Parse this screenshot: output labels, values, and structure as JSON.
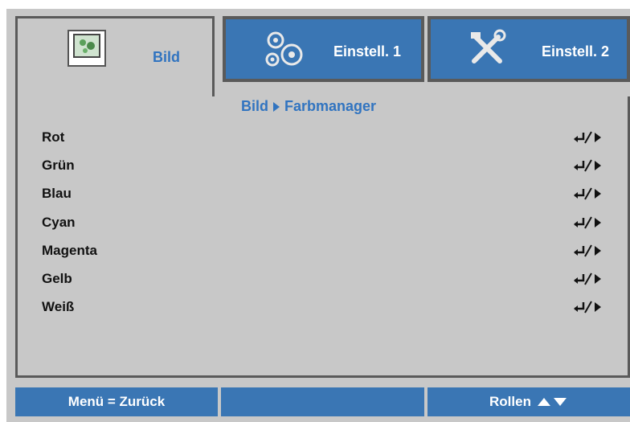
{
  "colors": {
    "accent": "#3174c0",
    "tab_bg": "#3a76b4",
    "panel_bg": "#c8c8c8",
    "border": "#5a5a5a"
  },
  "tabs": [
    {
      "label": "Bild",
      "icon": "picture-icon",
      "active": true
    },
    {
      "label": "Einstell. 1",
      "icon": "gears-icon",
      "active": false
    },
    {
      "label": "Einstell. 2",
      "icon": "tools-icon",
      "active": false
    }
  ],
  "breadcrumb": {
    "parent": "Bild",
    "current": "Farbmanager"
  },
  "menu": {
    "items": [
      {
        "label": "Rot",
        "action_icon": "enter-right-icon"
      },
      {
        "label": "Grün",
        "action_icon": "enter-right-icon"
      },
      {
        "label": "Blau",
        "action_icon": "enter-right-icon"
      },
      {
        "label": "Cyan",
        "action_icon": "enter-right-icon"
      },
      {
        "label": "Magenta",
        "action_icon": "enter-right-icon"
      },
      {
        "label": "Gelb",
        "action_icon": "enter-right-icon"
      },
      {
        "label": "Weiß",
        "action_icon": "enter-right-icon"
      }
    ]
  },
  "footer": {
    "back_label": "Menü = Zurück",
    "middle_label": "",
    "scroll_label": "Rollen"
  }
}
